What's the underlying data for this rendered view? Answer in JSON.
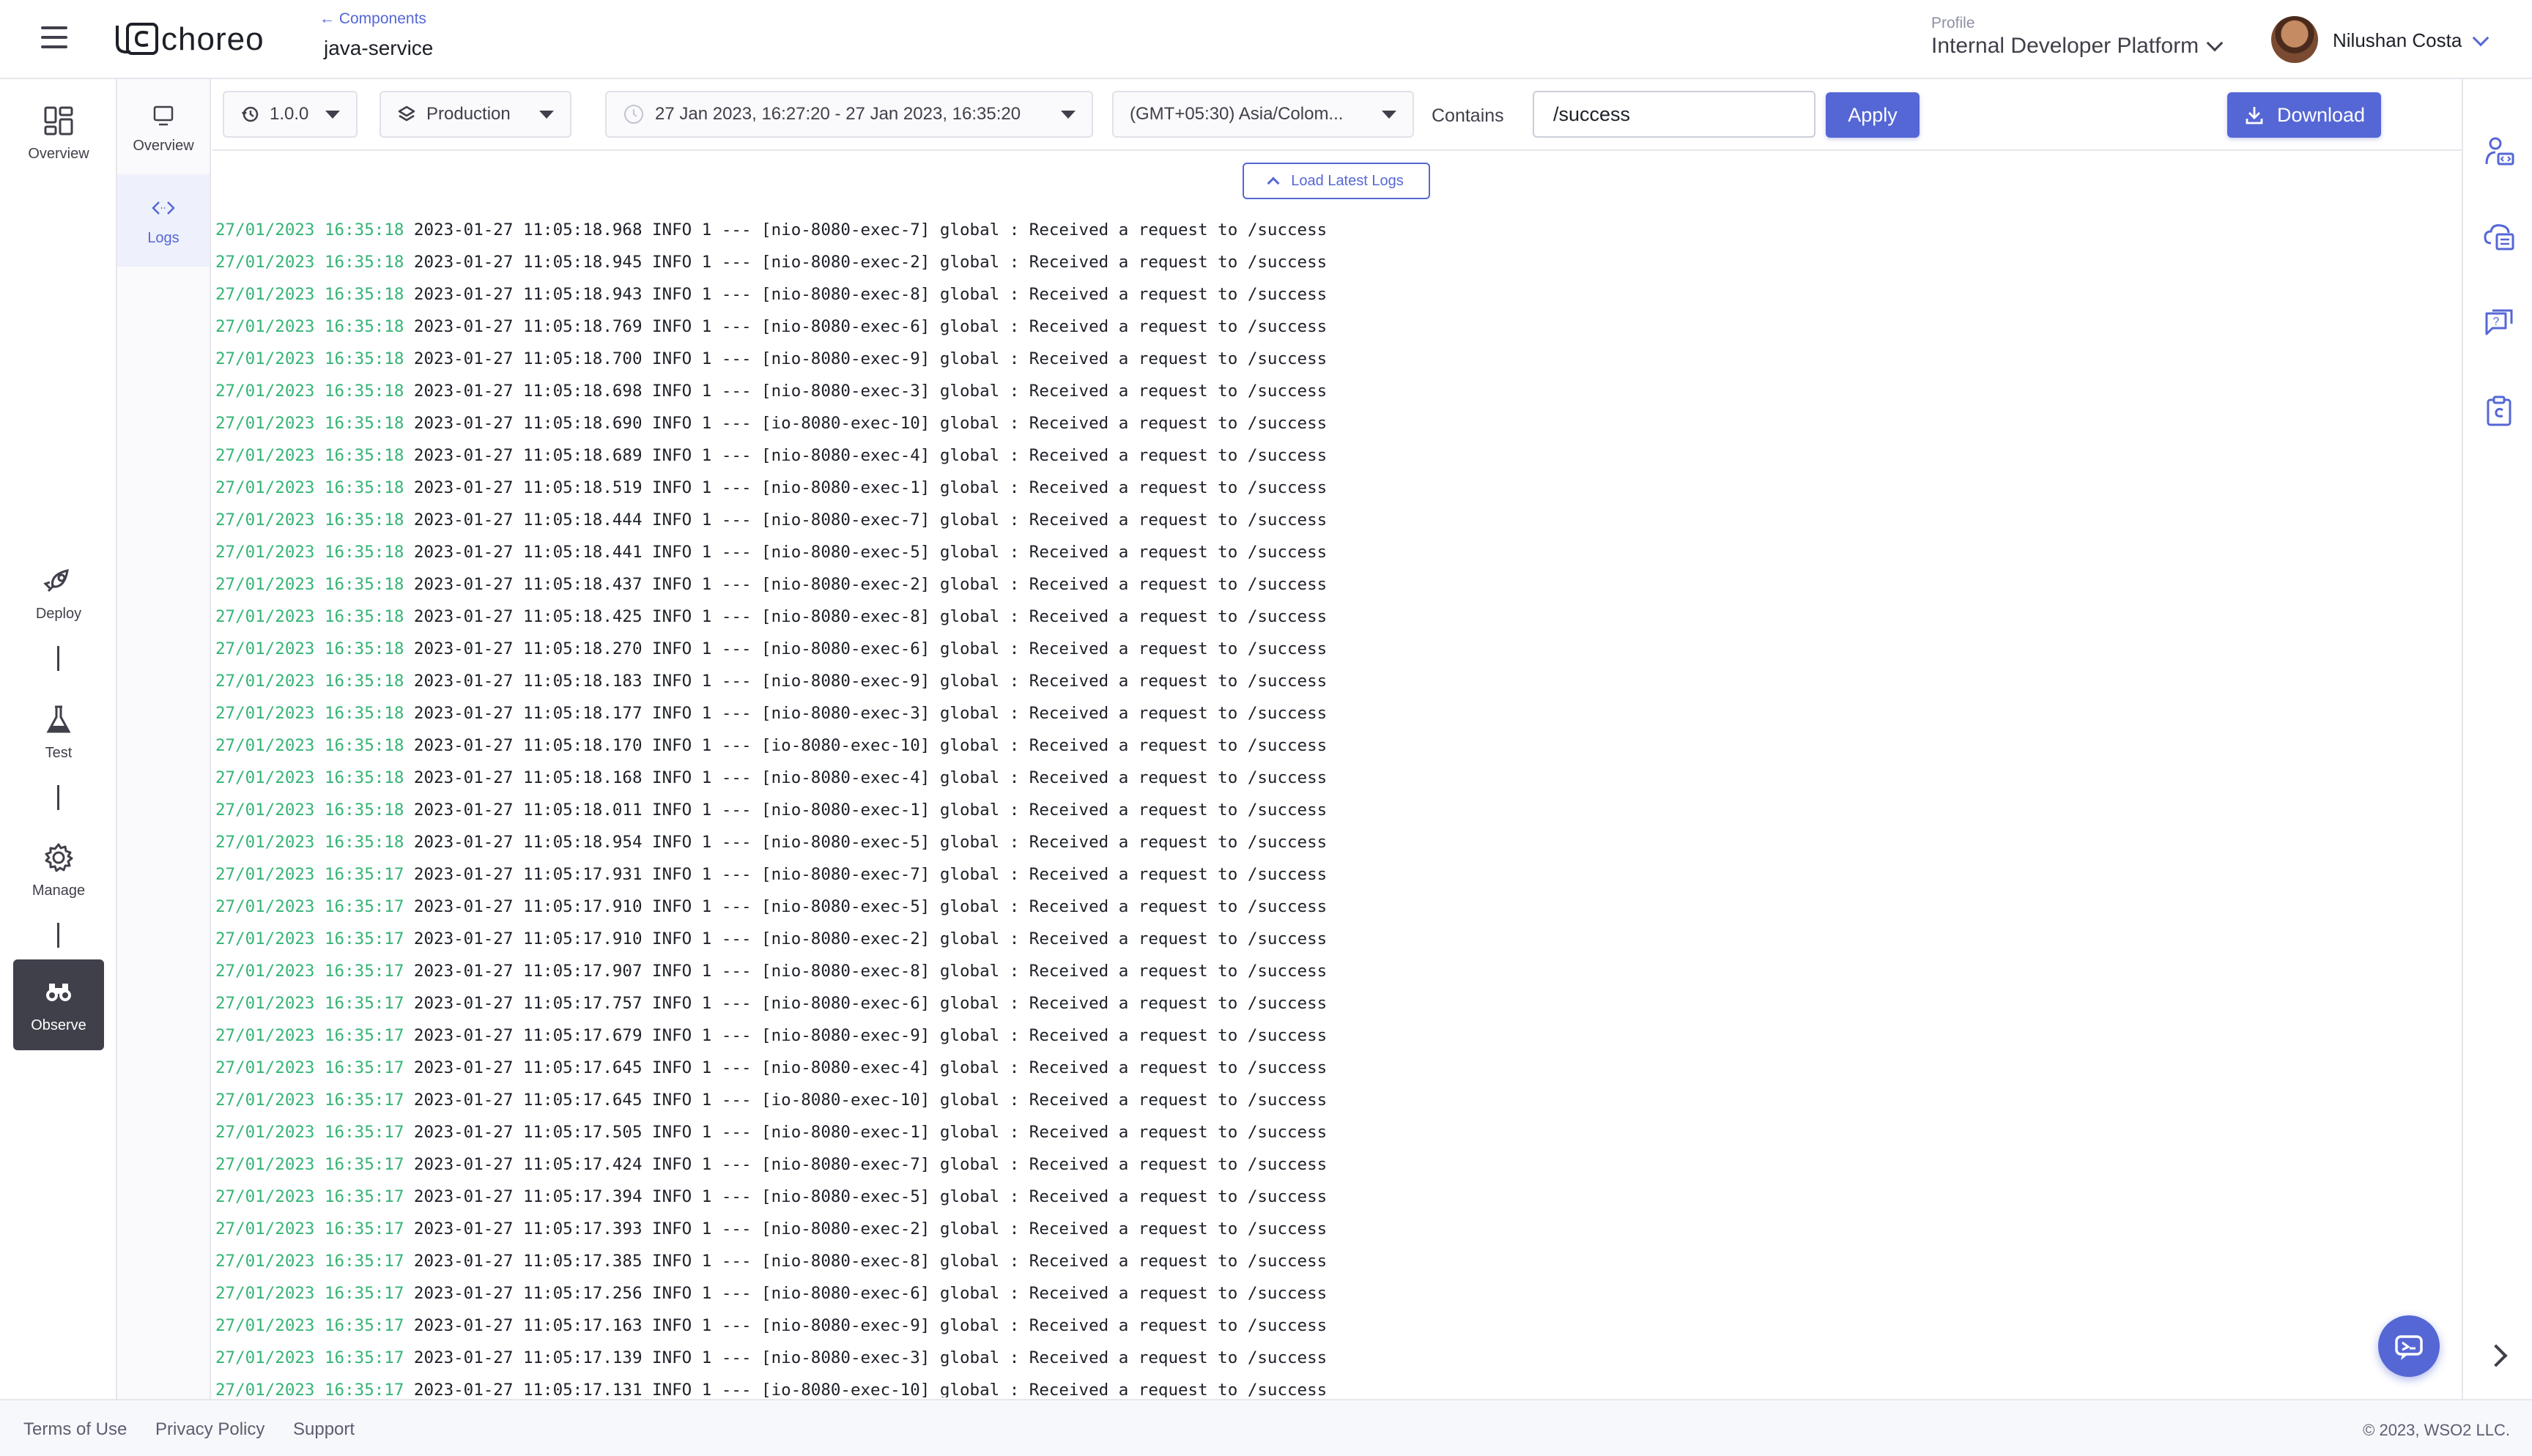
{
  "header": {
    "logo_text": "choreo",
    "breadcrumb_back": "← Components",
    "component_name": "java-service",
    "profile_label": "Profile",
    "profile_value": "Internal Developer Platform",
    "user_name": "Nilushan Costa"
  },
  "left_nav": {
    "overview": "Overview",
    "deploy": "Deploy",
    "test": "Test",
    "manage": "Manage",
    "observe": "Observe"
  },
  "sub_nav": {
    "overview": "Overview",
    "logs": "Logs"
  },
  "toolbar": {
    "version": "1.0.0",
    "environment": "Production",
    "date_range": "27 Jan 2023, 16:27:20 - 27 Jan 2023, 16:35:20",
    "timezone": "(GMT+05:30) Asia/Colom...",
    "filter_label": "Contains",
    "filter_value": "/success",
    "apply_label": "Apply",
    "download_label": "Download"
  },
  "load_latest_label": "Load Latest Logs",
  "logs": [
    {
      "ts": "27/01/2023 16:35:18",
      "msg": " 2023-01-27 11:05:18.968 INFO 1 --- [nio-8080-exec-7] global : Received a request to /success"
    },
    {
      "ts": "27/01/2023 16:35:18",
      "msg": " 2023-01-27 11:05:18.945 INFO 1 --- [nio-8080-exec-2] global : Received a request to /success"
    },
    {
      "ts": "27/01/2023 16:35:18",
      "msg": " 2023-01-27 11:05:18.943 INFO 1 --- [nio-8080-exec-8] global : Received a request to /success"
    },
    {
      "ts": "27/01/2023 16:35:18",
      "msg": " 2023-01-27 11:05:18.769 INFO 1 --- [nio-8080-exec-6] global : Received a request to /success"
    },
    {
      "ts": "27/01/2023 16:35:18",
      "msg": " 2023-01-27 11:05:18.700 INFO 1 --- [nio-8080-exec-9] global : Received a request to /success"
    },
    {
      "ts": "27/01/2023 16:35:18",
      "msg": " 2023-01-27 11:05:18.698 INFO 1 --- [nio-8080-exec-3] global : Received a request to /success"
    },
    {
      "ts": "27/01/2023 16:35:18",
      "msg": " 2023-01-27 11:05:18.690 INFO 1 --- [io-8080-exec-10] global : Received a request to /success"
    },
    {
      "ts": "27/01/2023 16:35:18",
      "msg": " 2023-01-27 11:05:18.689 INFO 1 --- [nio-8080-exec-4] global : Received a request to /success"
    },
    {
      "ts": "27/01/2023 16:35:18",
      "msg": " 2023-01-27 11:05:18.519 INFO 1 --- [nio-8080-exec-1] global : Received a request to /success"
    },
    {
      "ts": "27/01/2023 16:35:18",
      "msg": " 2023-01-27 11:05:18.444 INFO 1 --- [nio-8080-exec-7] global : Received a request to /success"
    },
    {
      "ts": "27/01/2023 16:35:18",
      "msg": " 2023-01-27 11:05:18.441 INFO 1 --- [nio-8080-exec-5] global : Received a request to /success"
    },
    {
      "ts": "27/01/2023 16:35:18",
      "msg": " 2023-01-27 11:05:18.437 INFO 1 --- [nio-8080-exec-2] global : Received a request to /success"
    },
    {
      "ts": "27/01/2023 16:35:18",
      "msg": " 2023-01-27 11:05:18.425 INFO 1 --- [nio-8080-exec-8] global : Received a request to /success"
    },
    {
      "ts": "27/01/2023 16:35:18",
      "msg": " 2023-01-27 11:05:18.270 INFO 1 --- [nio-8080-exec-6] global : Received a request to /success"
    },
    {
      "ts": "27/01/2023 16:35:18",
      "msg": " 2023-01-27 11:05:18.183 INFO 1 --- [nio-8080-exec-9] global : Received a request to /success"
    },
    {
      "ts": "27/01/2023 16:35:18",
      "msg": " 2023-01-27 11:05:18.177 INFO 1 --- [nio-8080-exec-3] global : Received a request to /success"
    },
    {
      "ts": "27/01/2023 16:35:18",
      "msg": " 2023-01-27 11:05:18.170 INFO 1 --- [io-8080-exec-10] global : Received a request to /success"
    },
    {
      "ts": "27/01/2023 16:35:18",
      "msg": " 2023-01-27 11:05:18.168 INFO 1 --- [nio-8080-exec-4] global : Received a request to /success"
    },
    {
      "ts": "27/01/2023 16:35:18",
      "msg": " 2023-01-27 11:05:18.011 INFO 1 --- [nio-8080-exec-1] global : Received a request to /success"
    },
    {
      "ts": "27/01/2023 16:35:18",
      "msg": " 2023-01-27 11:05:18.954 INFO 1 --- [nio-8080-exec-5] global : Received a request to /success"
    },
    {
      "ts": "27/01/2023 16:35:17",
      "msg": " 2023-01-27 11:05:17.931 INFO 1 --- [nio-8080-exec-7] global : Received a request to /success"
    },
    {
      "ts": "27/01/2023 16:35:17",
      "msg": " 2023-01-27 11:05:17.910 INFO 1 --- [nio-8080-exec-5] global : Received a request to /success"
    },
    {
      "ts": "27/01/2023 16:35:17",
      "msg": " 2023-01-27 11:05:17.910 INFO 1 --- [nio-8080-exec-2] global : Received a request to /success"
    },
    {
      "ts": "27/01/2023 16:35:17",
      "msg": " 2023-01-27 11:05:17.907 INFO 1 --- [nio-8080-exec-8] global : Received a request to /success"
    },
    {
      "ts": "27/01/2023 16:35:17",
      "msg": " 2023-01-27 11:05:17.757 INFO 1 --- [nio-8080-exec-6] global : Received a request to /success"
    },
    {
      "ts": "27/01/2023 16:35:17",
      "msg": " 2023-01-27 11:05:17.679 INFO 1 --- [nio-8080-exec-9] global : Received a request to /success"
    },
    {
      "ts": "27/01/2023 16:35:17",
      "msg": " 2023-01-27 11:05:17.645 INFO 1 --- [nio-8080-exec-4] global : Received a request to /success"
    },
    {
      "ts": "27/01/2023 16:35:17",
      "msg": " 2023-01-27 11:05:17.645 INFO 1 --- [io-8080-exec-10] global : Received a request to /success"
    },
    {
      "ts": "27/01/2023 16:35:17",
      "msg": " 2023-01-27 11:05:17.505 INFO 1 --- [nio-8080-exec-1] global : Received a request to /success"
    },
    {
      "ts": "27/01/2023 16:35:17",
      "msg": " 2023-01-27 11:05:17.424 INFO 1 --- [nio-8080-exec-7] global : Received a request to /success"
    },
    {
      "ts": "27/01/2023 16:35:17",
      "msg": " 2023-01-27 11:05:17.394 INFO 1 --- [nio-8080-exec-5] global : Received a request to /success"
    },
    {
      "ts": "27/01/2023 16:35:17",
      "msg": " 2023-01-27 11:05:17.393 INFO 1 --- [nio-8080-exec-2] global : Received a request to /success"
    },
    {
      "ts": "27/01/2023 16:35:17",
      "msg": " 2023-01-27 11:05:17.385 INFO 1 --- [nio-8080-exec-8] global : Received a request to /success"
    },
    {
      "ts": "27/01/2023 16:35:17",
      "msg": " 2023-01-27 11:05:17.256 INFO 1 --- [nio-8080-exec-6] global : Received a request to /success"
    },
    {
      "ts": "27/01/2023 16:35:17",
      "msg": " 2023-01-27 11:05:17.163 INFO 1 --- [nio-8080-exec-9] global : Received a request to /success"
    },
    {
      "ts": "27/01/2023 16:35:17",
      "msg": " 2023-01-27 11:05:17.139 INFO 1 --- [nio-8080-exec-3] global : Received a request to /success"
    },
    {
      "ts": "27/01/2023 16:35:17",
      "msg": " 2023-01-27 11:05:17.131 INFO 1 --- [io-8080-exec-10] global : Received a request to /success"
    }
  ],
  "footer": {
    "terms": "Terms of Use",
    "privacy": "Privacy Policy",
    "support": "Support",
    "copyright": "© 2023, WSO2 LLC."
  },
  "colors": {
    "accent": "#5567d5",
    "log_timestamp": "#36b475",
    "text": "#40404b",
    "active_nav": "#40404b"
  }
}
